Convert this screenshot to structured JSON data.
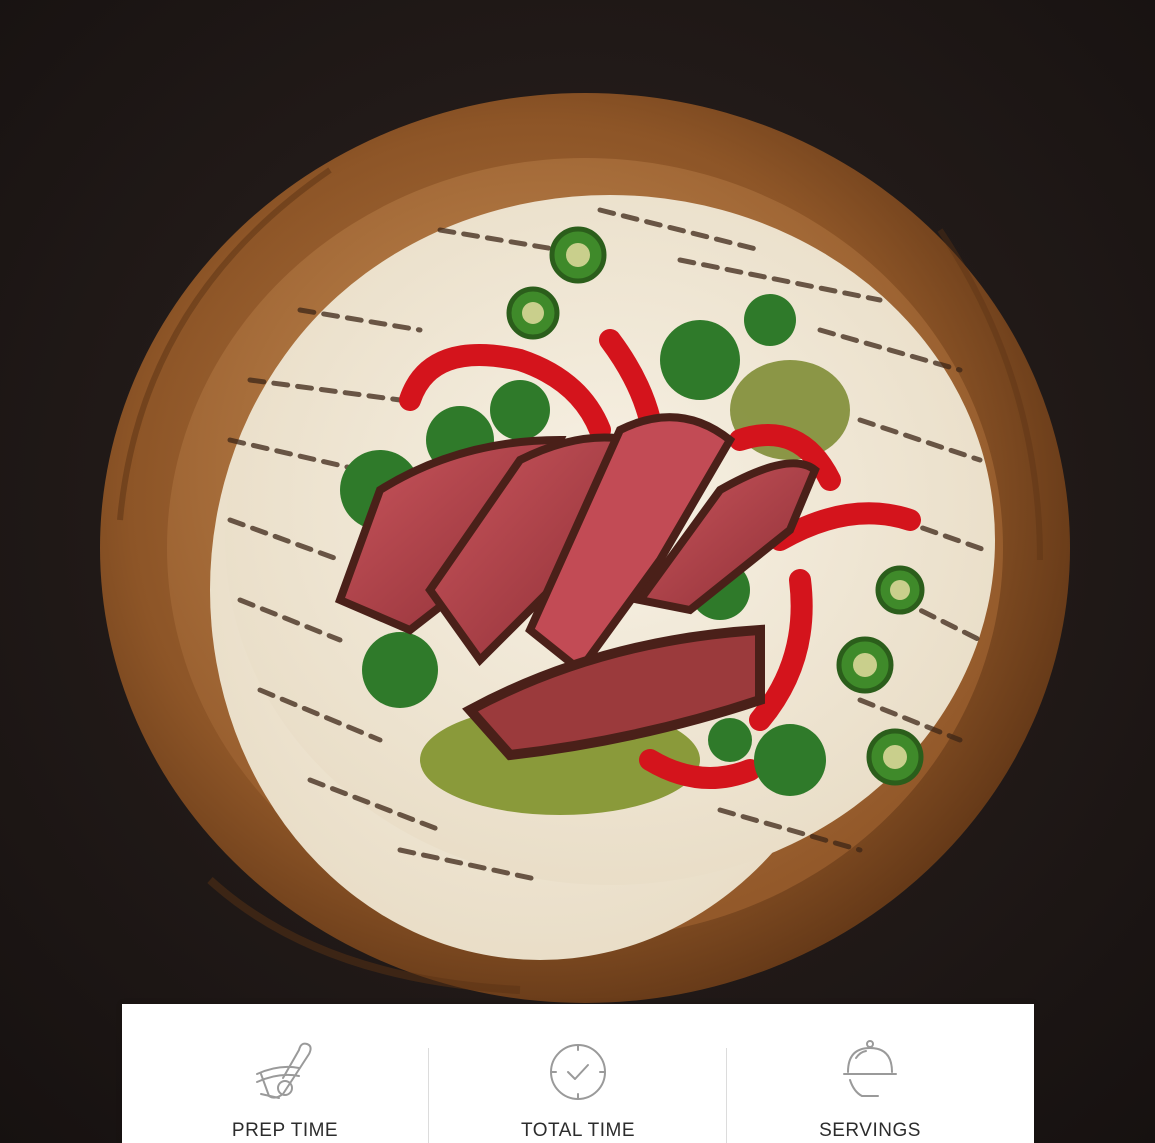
{
  "hero": {
    "description_icon": "food-photo"
  },
  "stats": [
    {
      "label": "PREP TIME",
      "icon": "cutting-board-icon"
    },
    {
      "label": "TOTAL TIME",
      "icon": "clock-icon"
    },
    {
      "label": "SERVINGS",
      "icon": "cloche-icon"
    }
  ],
  "colors": {
    "background": "#211a18",
    "card": "#ffffff",
    "text": "#2c2c2c",
    "icon_stroke": "#9a9a9a"
  }
}
